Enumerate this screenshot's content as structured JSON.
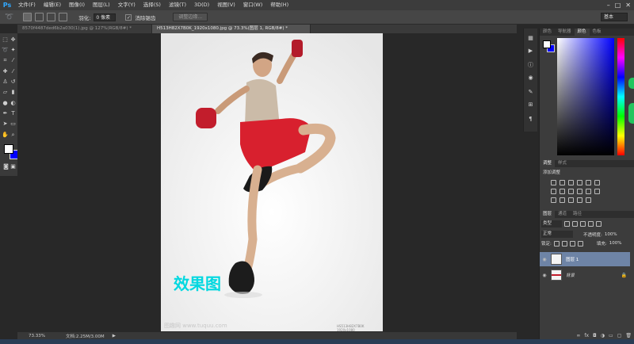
{
  "app": {
    "logo": "Ps"
  },
  "menu": [
    "文件(F)",
    "编辑(E)",
    "图像(I)",
    "图层(L)",
    "文字(Y)",
    "选择(S)",
    "滤镜(T)",
    "3D(D)",
    "视图(V)",
    "窗口(W)",
    "帮助(H)"
  ],
  "options": {
    "feather_label": "羽化:",
    "feather_value": "0 像素",
    "antialias_label": "消除锯齿",
    "refine_button": "调整边缘...",
    "workspace": "基本"
  },
  "tabs": [
    {
      "label": "8570f4487ded6b2a030(1).jpg @ 127%(RGB/8#) *"
    },
    {
      "label": "H513H82X7B0K_1920x1080.jpg @ 73.3%(图层 1, RGB/8#) *"
    }
  ],
  "document": {
    "effect_text": "效果图",
    "watermark": "图趣网 www.tuquu.com",
    "corner_text": "HS513H82X7B0K 1920x1080"
  },
  "status": {
    "zoom": "73.33%",
    "doc_size": "文档:2.25M/3.00M"
  },
  "panels": {
    "top_tabs": [
      "颜色",
      "导航器",
      "颜色",
      "色板"
    ],
    "adjust_tabs": [
      "调整",
      "样式"
    ],
    "adjust_add": "添加调整",
    "layers_tabs": [
      "图层",
      "通道",
      "路径"
    ],
    "kind_label": "类型",
    "blend_mode": "正常",
    "opacity_label": "不透明度:",
    "opacity_value": "100%",
    "lock_label": "锁定:",
    "fill_label": "填充:",
    "fill_value": "100%",
    "layers": [
      {
        "name": "图层 1",
        "selected": true
      },
      {
        "name": "背景",
        "selected": false
      }
    ]
  },
  "colors": {
    "foreground": "#ffffff",
    "background": "#0000ff",
    "accent": "#00d8e0",
    "shorts": "#d8202e"
  }
}
